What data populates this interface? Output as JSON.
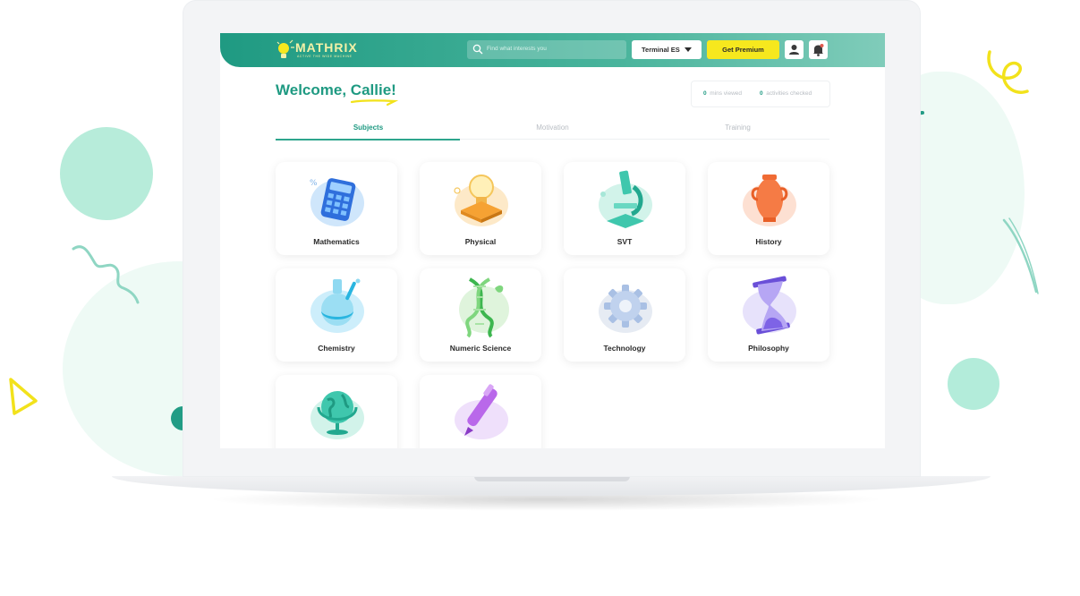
{
  "app": {
    "logo_text": "MATHRIX",
    "logo_tagline": "ACTIVE THE WIDE MACHINE",
    "search_placeholder": "Find what interests you",
    "class_select": "Terminal ES",
    "premium_label": "Get Premium"
  },
  "welcome": {
    "greeting": "Welcome,",
    "name": "Callie!"
  },
  "stats": {
    "mins_value": "0",
    "mins_label": "mins viewed",
    "activities_value": "0",
    "activities_label": "activities checked"
  },
  "tabs": [
    {
      "label": "Subjects",
      "active": true
    },
    {
      "label": "Motivation",
      "active": false
    },
    {
      "label": "Training",
      "active": false
    }
  ],
  "subjects": [
    {
      "label": "Mathematics",
      "icon": "calculator-icon"
    },
    {
      "label": "Physical",
      "icon": "lightbulb-icon"
    },
    {
      "label": "SVT",
      "icon": "microscope-icon"
    },
    {
      "label": "History",
      "icon": "vase-icon"
    },
    {
      "label": "Chemistry",
      "icon": "flask-icon"
    },
    {
      "label": "Numeric Science",
      "icon": "dna-icon"
    },
    {
      "label": "Technology",
      "icon": "gear-icon"
    },
    {
      "label": "Philosophy",
      "icon": "hourglass-icon"
    },
    {
      "label": "",
      "icon": "globe-icon"
    },
    {
      "label": "",
      "icon": "pen-icon"
    }
  ],
  "colors": {
    "brand": "#1f9a82",
    "premium": "#f6e81e",
    "mint": "#b7ecda"
  }
}
